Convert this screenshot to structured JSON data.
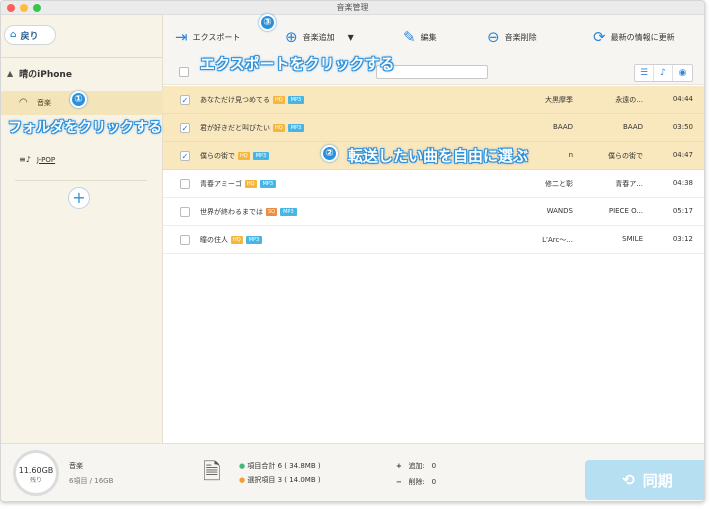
{
  "window": {
    "title": "音楽管理"
  },
  "sidebar": {
    "back_label": "戻り",
    "device_name": "晴のiPhone",
    "items": [
      {
        "label": "音楽"
      },
      {
        "label": "J-POP"
      }
    ],
    "add_symbol": "+"
  },
  "toolbar": {
    "export_label": "エクスポート",
    "add_music_label": "音楽追加",
    "edit_label": "編集",
    "delete_label": "音楽削除",
    "refresh_label": "最新の情報に更新"
  },
  "tracks": [
    {
      "title": "あなただけ見つめてる",
      "quality": "HQ",
      "format": "MP3",
      "artist": "大黒摩季",
      "album": "永遠の...",
      "duration": "04:44",
      "checked": true
    },
    {
      "title": "君が好きだと叫びたい",
      "quality": "HQ",
      "format": "MP3",
      "artist": "BAAD",
      "album": "BAAD",
      "duration": "03:50",
      "checked": true
    },
    {
      "title": "僕らの街で",
      "quality": "HQ",
      "format": "MP3",
      "artist": "n",
      "album": "僕らの街で",
      "duration": "04:47",
      "checked": true
    },
    {
      "title": "青春アミーゴ",
      "quality": "HQ",
      "format": "MP3",
      "artist": "修二と彰",
      "album": "青春ア...",
      "duration": "04:38",
      "checked": false
    },
    {
      "title": "世界が終わるまでは",
      "quality": "SQ",
      "format": "MP3",
      "artist": "WANDS",
      "album": "PIECE O...",
      "duration": "05:17",
      "checked": false
    },
    {
      "title": "瞳の住人",
      "quality": "HQ",
      "format": "MP3",
      "artist": "L'Arc～...",
      "album": "SMILE",
      "duration": "03:12",
      "checked": false
    }
  ],
  "footer": {
    "storage_free": "11.60GB",
    "storage_free_label": "残り",
    "category": "音楽",
    "count": "6項目 / 16GB",
    "total_items": "項目合計 6 ( 34.8MB )",
    "selected_items": "選択項目 3 ( 14.0MB )",
    "add_label": "追加:",
    "add_count": "0",
    "delete_label": "削除:",
    "delete_count": "0",
    "sync_label": "同期"
  },
  "annotations": {
    "step1_num": "①",
    "step1_text": "フォルダをクリックする",
    "step2_num": "②",
    "step2_text": "転送したい曲を自由に選ぶ",
    "step3_num": "③",
    "step3_text": "エクスポートをクリックする"
  },
  "colors": {
    "accent": "#2e86d8",
    "selected_row": "#f9e7bd",
    "hq_badge": "#f5b73b",
    "sq_badge": "#f08a3c",
    "format_badge": "#47b6e6",
    "sync_button": "#b7dff2",
    "annotation": "#2b8fd9"
  },
  "icons": {
    "back": "house-icon",
    "device": "triangle-up-icon",
    "music": "headphones-icon",
    "playlist": "playlist-icon",
    "export": "export-icon",
    "add": "plus-circle-icon",
    "edit": "pencil-icon",
    "delete": "minus-circle-icon",
    "refresh": "refresh-icon",
    "sync": "sync-icon"
  }
}
